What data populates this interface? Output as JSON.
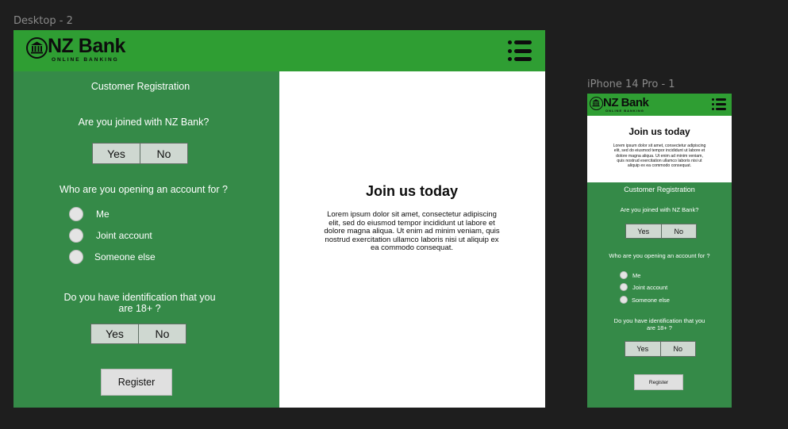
{
  "desktop": {
    "frame_label": "Desktop - 2",
    "logo": {
      "name": "NZ Bank",
      "tagline": "ONLINE BANKING",
      "icon": "bank-icon"
    },
    "menu_icon": "list-menu-icon",
    "form": {
      "title": "Customer Registration",
      "q1": "Are you joined with NZ Bank?",
      "q1_yes": "Yes",
      "q1_no": "No",
      "q2": "Who are you opening an account for ?",
      "options": [
        "Me",
        "Joint account",
        "Someone else"
      ],
      "q3_line1": "Do you have identification that you",
      "q3_line2": "are 18+ ?",
      "q3_yes": "Yes",
      "q3_no": "No",
      "register": "Register"
    },
    "promo": {
      "title": "Join us today",
      "body_lines": [
        "Lorem ipsum dolor sit amet, consectetur adipiscing",
        "elit, sed do eiusmod tempor incididunt ut labore et",
        "dolore magna aliqua. Ut enim ad minim veniam, quis",
        "nostrud exercitation ullamco laboris nisi ut aliquip ex",
        "ea commodo consequat."
      ]
    }
  },
  "phone": {
    "frame_label": "iPhone 14 Pro - 1",
    "logo": {
      "name": "NZ Bank",
      "tagline": "ONLINE BANKING",
      "icon": "bank-icon"
    },
    "menu_icon": "list-menu-icon",
    "promo": {
      "title": "Join us today",
      "body_lines": [
        "Lorem ipsum dolor sit amet, consectetur adipiscing",
        "elit, sed do eiusmod tempor incididunt ut labore et",
        "dolore magna aliqua. Ut enim ad minim veniam,",
        "quis nostrud exercitation ullamco laboris nisi ut",
        "aliquip ex ea commodo consequat."
      ]
    },
    "form": {
      "title": "Customer Registration",
      "q1": "Are you joined with NZ Bank?",
      "q1_yes": "Yes",
      "q1_no": "No",
      "q2": "Who are you opening an account for ?",
      "options": [
        "Me",
        "Joint account",
        "Someone else"
      ],
      "q3_line1": "Do you have identification that you",
      "q3_line2": "are 18+ ?",
      "q3_yes": "Yes",
      "q3_no": "No",
      "register": "Register"
    }
  },
  "colors": {
    "header": "#2f9e33",
    "panel": "#358a48",
    "canvas": "#1e1e1e"
  }
}
